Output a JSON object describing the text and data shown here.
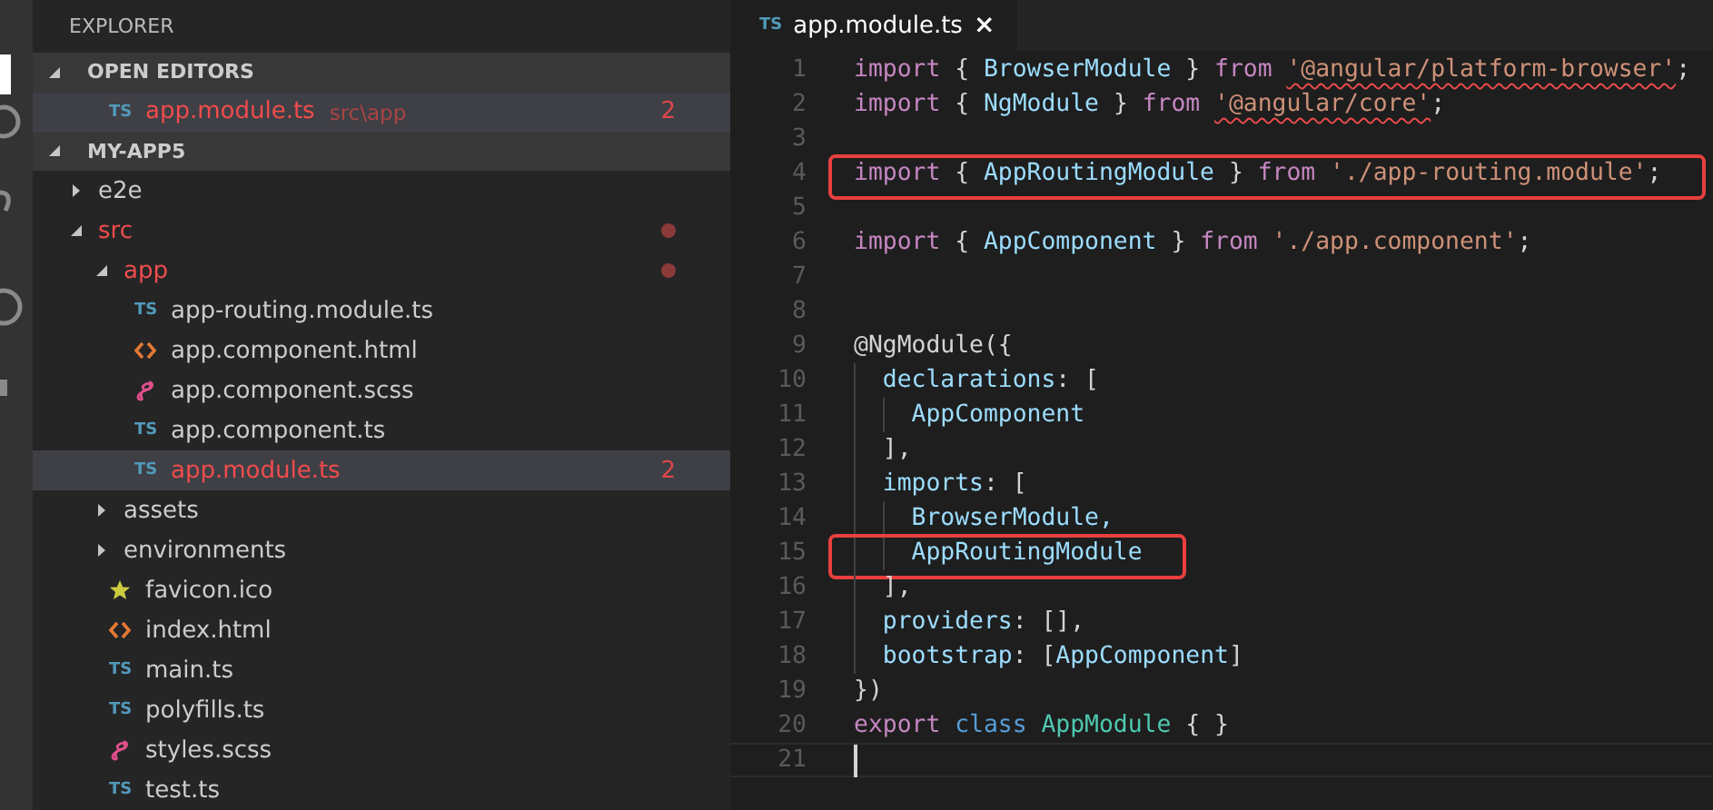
{
  "sidebar": {
    "title": "EXPLORER",
    "sections": [
      {
        "label": "OPEN EDITORS",
        "expanded": true,
        "items": [
          {
            "kind": "ts",
            "badge": "TS",
            "label": "app.module.ts",
            "path": "src\\app",
            "errors": true,
            "problems": "2",
            "selected": true
          }
        ]
      },
      {
        "label": "MY-APP5",
        "expanded": true,
        "items": [
          {
            "kind": "folder",
            "label": "e2e",
            "expanded": false,
            "errors": false,
            "selected": false
          },
          {
            "kind": "folder",
            "label": "src",
            "expanded": true,
            "errors": true,
            "selected": false,
            "children": [
              {
                "kind": "folder",
                "label": "app",
                "expanded": true,
                "errors": true,
                "selected": false,
                "children": [
                  {
                    "kind": "ts",
                    "badge": "TS",
                    "label": "app-routing.module.ts",
                    "errors": false,
                    "selected": false
                  },
                  {
                    "kind": "html",
                    "label": "app.component.html",
                    "errors": false,
                    "selected": false
                  },
                  {
                    "kind": "scss",
                    "label": "app.component.scss",
                    "errors": false,
                    "selected": false
                  },
                  {
                    "kind": "ts",
                    "badge": "TS",
                    "label": "app.component.ts",
                    "errors": false,
                    "selected": false
                  },
                  {
                    "kind": "ts",
                    "badge": "TS",
                    "label": "app.module.ts",
                    "errors": true,
                    "problems": "2",
                    "selected": true
                  }
                ]
              },
              {
                "kind": "folder",
                "label": "assets",
                "expanded": false,
                "errors": false,
                "selected": false
              },
              {
                "kind": "folder",
                "label": "environments",
                "expanded": false,
                "errors": false,
                "selected": false
              },
              {
                "kind": "favicon",
                "label": "favicon.ico",
                "errors": false,
                "selected": false
              },
              {
                "kind": "html",
                "label": "index.html",
                "errors": false,
                "selected": false
              },
              {
                "kind": "ts",
                "badge": "TS",
                "label": "main.ts",
                "errors": false,
                "selected": false
              },
              {
                "kind": "ts",
                "badge": "TS",
                "label": "polyfills.ts",
                "errors": false,
                "selected": false
              },
              {
                "kind": "scss",
                "label": "styles.scss",
                "errors": false,
                "selected": false
              },
              {
                "kind": "ts",
                "badge": "TS",
                "label": "test.ts",
                "errors": false,
                "selected": false
              }
            ]
          }
        ]
      }
    ]
  },
  "tabs": [
    {
      "badge": "TS",
      "label": "app.module.ts",
      "close": "×",
      "selected": true
    }
  ],
  "code": {
    "lines": [
      {
        "number": "1",
        "tokens": [
          {
            "text": "import",
            "kind": "keyword"
          },
          {
            "text": " { ",
            "kind": "punct"
          },
          {
            "text": "BrowserModule",
            "kind": "ident"
          },
          {
            "text": " } ",
            "kind": "punct"
          },
          {
            "text": "from ",
            "kind": "keyword"
          },
          {
            "text": "'@angular/platform-browser'",
            "kind": "string",
            "error": true
          },
          {
            "text": ";",
            "kind": "punct"
          }
        ]
      },
      {
        "number": "2",
        "tokens": [
          {
            "text": "import",
            "kind": "keyword"
          },
          {
            "text": " { ",
            "kind": "punct"
          },
          {
            "text": "NgModule",
            "kind": "ident"
          },
          {
            "text": " } ",
            "kind": "punct"
          },
          {
            "text": "from ",
            "kind": "keyword"
          },
          {
            "text": "'@angular/core'",
            "kind": "string",
            "error": true
          },
          {
            "text": ";",
            "kind": "punct"
          }
        ]
      },
      {
        "number": "3"
      },
      {
        "number": "4",
        "boxed": true,
        "tokens": [
          {
            "text": "import",
            "kind": "keyword"
          },
          {
            "text": " { ",
            "kind": "punct"
          },
          {
            "text": "AppRoutingModule",
            "kind": "ident"
          },
          {
            "text": " } ",
            "kind": "punct"
          },
          {
            "text": "from ",
            "kind": "keyword"
          },
          {
            "text": "'./app-routing.module'",
            "kind": "string",
            "error": false
          },
          {
            "text": ";",
            "kind": "punct"
          }
        ]
      },
      {
        "number": "5"
      },
      {
        "number": "6",
        "tokens": [
          {
            "text": "import",
            "kind": "keyword"
          },
          {
            "text": " { ",
            "kind": "punct"
          },
          {
            "text": "AppComponent",
            "kind": "ident"
          },
          {
            "text": " } ",
            "kind": "punct"
          },
          {
            "text": "from ",
            "kind": "keyword"
          },
          {
            "text": "'./app.component'",
            "kind": "string",
            "error": false
          },
          {
            "text": ";",
            "kind": "punct"
          }
        ]
      },
      {
        "number": "7"
      },
      {
        "number": "8"
      },
      {
        "number": "9",
        "tokens": [
          {
            "text": "@NgModule({",
            "kind": "punct"
          }
        ]
      },
      {
        "number": "10",
        "tokens": [
          {
            "text": "  declarations",
            "kind": "ident"
          },
          {
            "text": ": [",
            "kind": "punct"
          }
        ]
      },
      {
        "number": "11",
        "tokens": [
          {
            "text": "    AppComponent",
            "kind": "ident"
          }
        ]
      },
      {
        "number": "12",
        "tokens": [
          {
            "text": "  ],",
            "kind": "punct"
          }
        ]
      },
      {
        "number": "13",
        "tokens": [
          {
            "text": "  imports",
            "kind": "ident"
          },
          {
            "text": ": [",
            "kind": "punct"
          }
        ]
      },
      {
        "number": "14",
        "tokens": [
          {
            "text": "    BrowserModule,",
            "kind": "ident"
          }
        ]
      },
      {
        "number": "15",
        "boxed": true,
        "tokens": [
          {
            "text": "    AppRoutingModule",
            "kind": "ident"
          }
        ]
      },
      {
        "number": "16",
        "tokens": [
          {
            "text": "  ],",
            "kind": "punct"
          }
        ]
      },
      {
        "number": "17",
        "tokens": [
          {
            "text": "  providers",
            "kind": "ident"
          },
          {
            "text": ": [],",
            "kind": "punct"
          }
        ]
      },
      {
        "number": "18",
        "tokens": [
          {
            "text": "  bootstrap",
            "kind": "ident"
          },
          {
            "text": ": [",
            "kind": "punct"
          },
          {
            "text": "AppComponent",
            "kind": "ident"
          },
          {
            "text": "]",
            "kind": "punct"
          }
        ]
      },
      {
        "number": "19",
        "tokens": [
          {
            "text": "})",
            "kind": "punct"
          }
        ]
      },
      {
        "number": "20",
        "tokens": [
          {
            "text": "export ",
            "kind": "keyword"
          },
          {
            "text": "class ",
            "kind": "storage"
          },
          {
            "text": "AppModule",
            "kind": "type"
          },
          {
            "text": " { }",
            "kind": "punct"
          }
        ]
      },
      {
        "number": "21",
        "current": true
      }
    ]
  }
}
